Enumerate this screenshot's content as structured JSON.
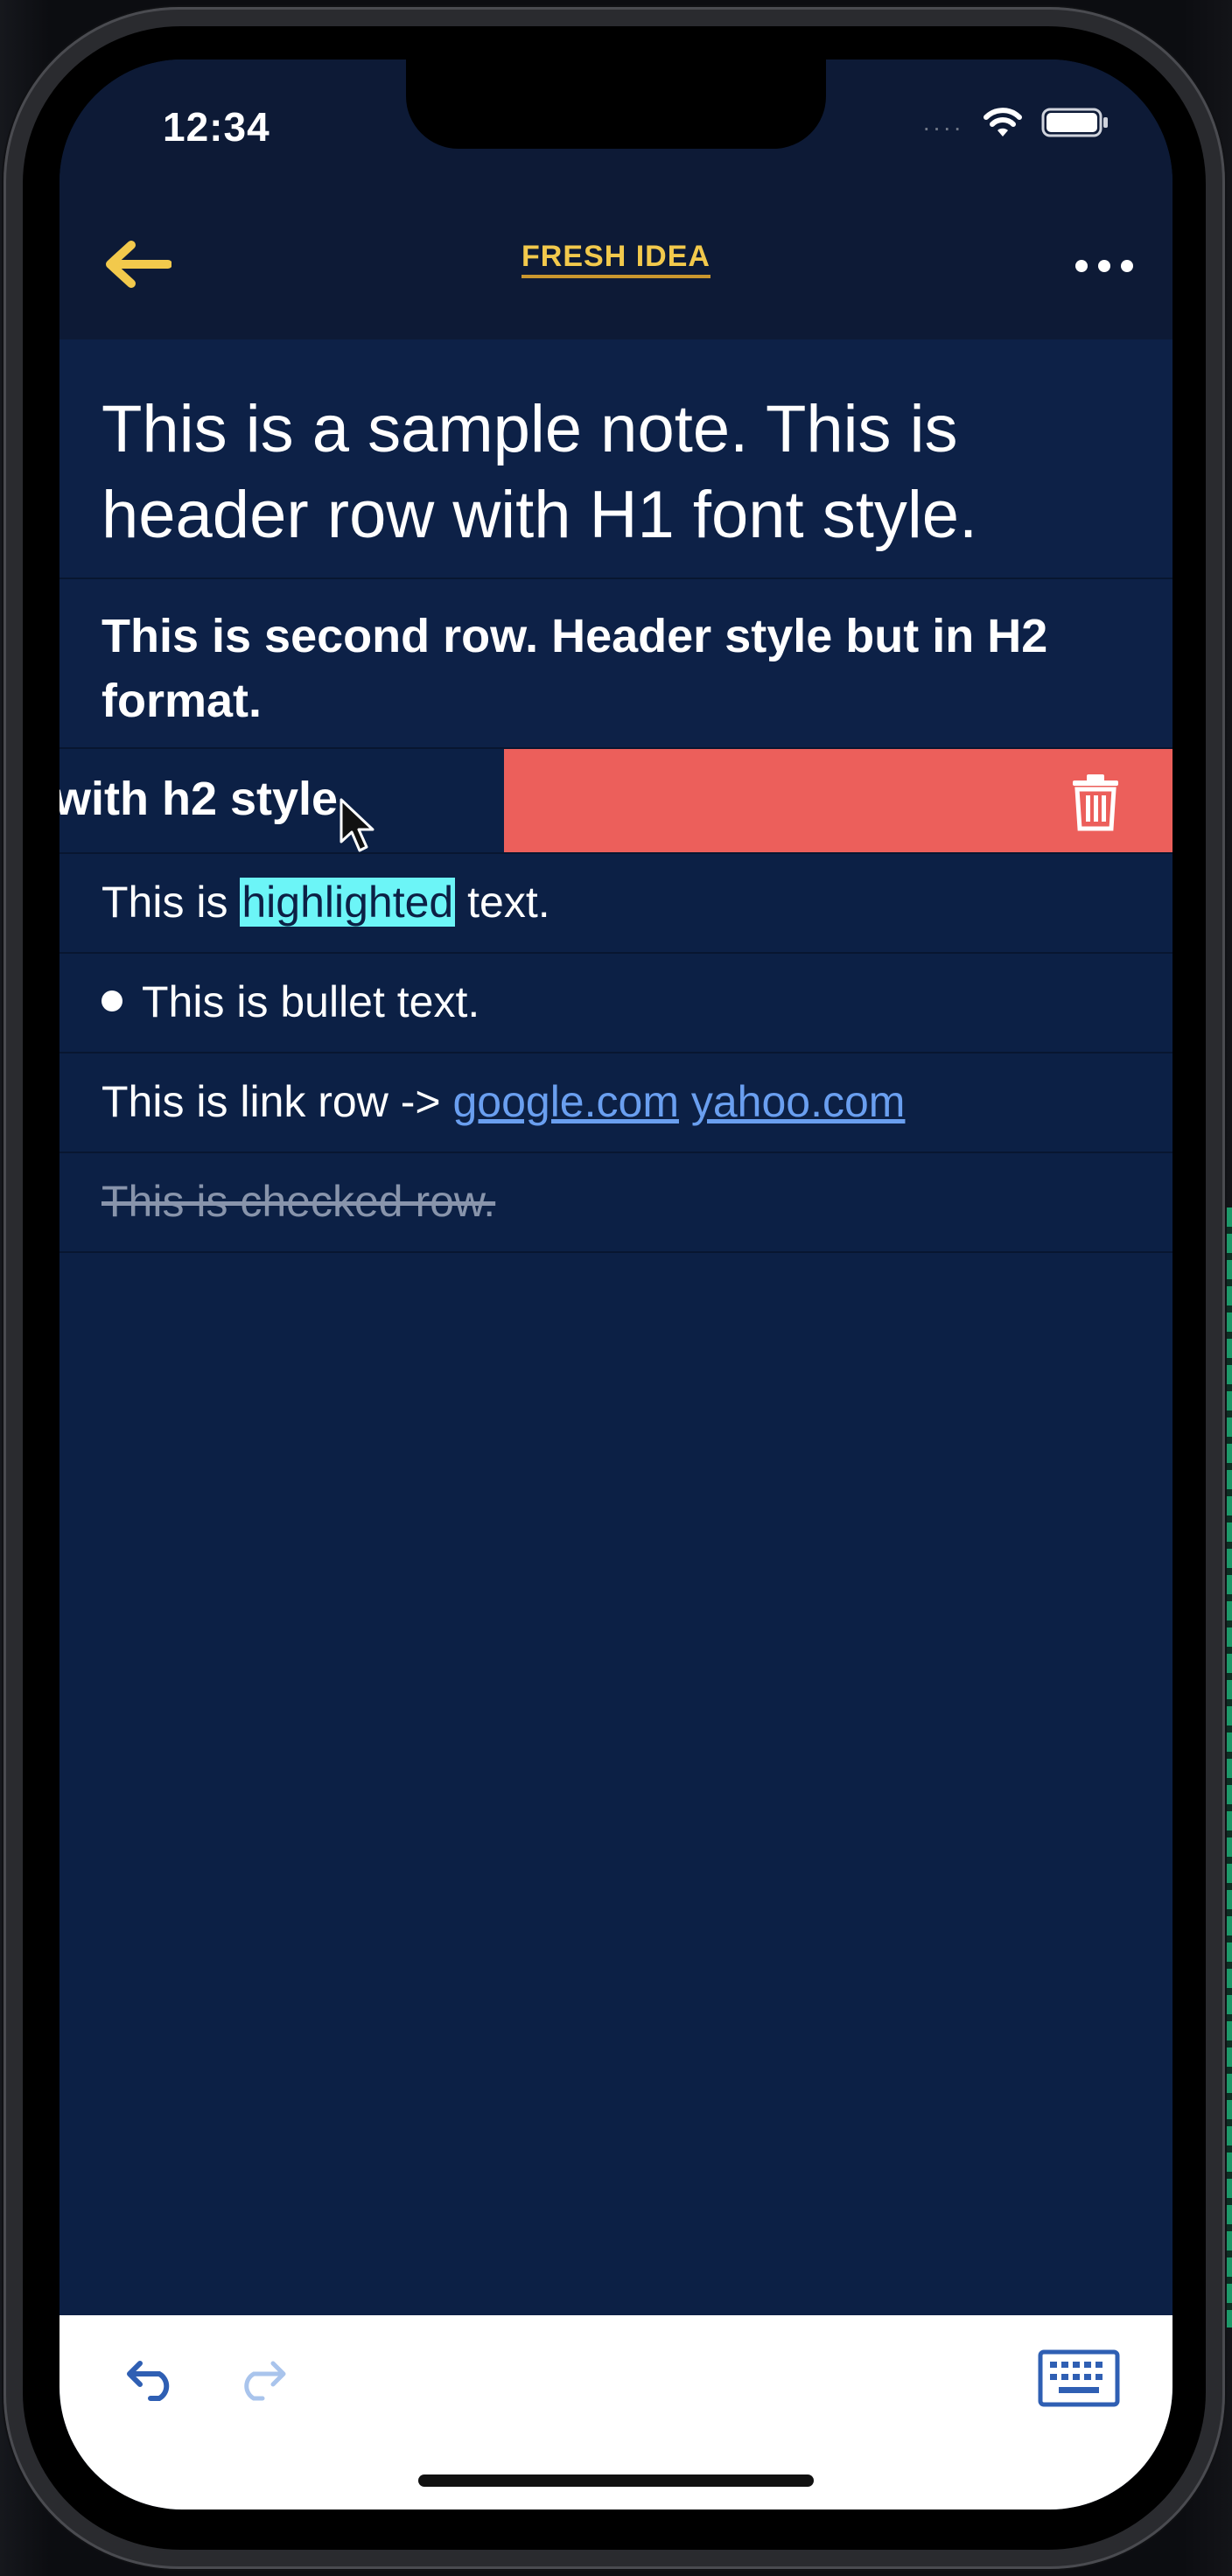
{
  "status_bar": {
    "time": "12:34",
    "signal": "....",
    "icons": [
      "wifi-icon",
      "battery-icon"
    ]
  },
  "header": {
    "back_icon": "arrow-left-icon",
    "title": "FRESH IDEA",
    "more_icon": "ellipsis-icon"
  },
  "note": {
    "h1_row": "This is a sample note. This is header row with H1 font style.",
    "h2_row": "This is second row. Header style but in H2 format.",
    "swiped_row": {
      "visible_text": "with h2 style",
      "action_icon": "trash-icon"
    },
    "highlight_row": {
      "before": "This is ",
      "highlighted": "highlighted",
      "after": " text."
    },
    "bullet_row": "This is bullet text.",
    "link_row": {
      "prefix": "This is link row -> ",
      "links": [
        "google.com",
        "yahoo.com"
      ]
    },
    "checked_row": "This is checked row."
  },
  "toolbar": {
    "undo_icon": "undo-icon",
    "redo_icon": "redo-icon",
    "keyboard_icon": "keyboard-icon"
  },
  "colors": {
    "background": "#0c2045",
    "header_background": "#0d1a36",
    "accent_yellow": "#f2c94c",
    "delete_red": "#ec5f5b",
    "highlight": "#6cf5f7",
    "link": "#6a9ff0"
  }
}
